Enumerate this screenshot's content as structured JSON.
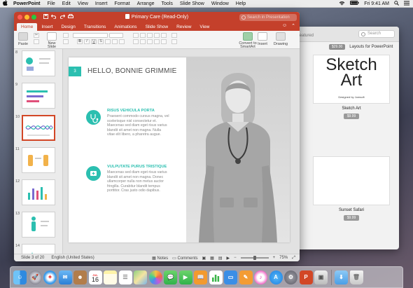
{
  "menubar": {
    "apple": "",
    "app_name": "PowerPoint",
    "items": [
      "File",
      "Edit",
      "View",
      "Insert",
      "Format",
      "Arrange",
      "Tools",
      "Slide Show",
      "Window",
      "Help"
    ],
    "clock": "Fri 9:41 AM"
  },
  "window": {
    "title": "Primary Care (Read-Only)",
    "search_placeholder": "Search in Presentation",
    "tabs": [
      "Home",
      "Insert",
      "Design",
      "Transitions",
      "Animations",
      "Slide Show",
      "Review",
      "View"
    ],
    "active_tab": "Home"
  },
  "ribbon": {
    "paste": "Paste",
    "new_slide": "New\nSlide",
    "convert_smartart": "Convert to\nSmartArt",
    "insert": "Insert",
    "drawing": "Drawing"
  },
  "thumbnails": [
    {
      "num": "8"
    },
    {
      "num": "9"
    },
    {
      "num": "10"
    },
    {
      "num": "11"
    },
    {
      "num": "12"
    },
    {
      "num": "13"
    },
    {
      "num": "14"
    }
  ],
  "slide": {
    "number": "3",
    "title": "HELLO, BONNIE GRIMMIE",
    "section1": {
      "heading": "RISUS VEHICULA PORTA",
      "body": [
        "Praesent commodo cursus magna, vel",
        "scelerisque nisl consectetur et.",
        "Maecenas sed diam eget risus varius",
        "blandit sit amet non magna. Nulla",
        "vitae elit libero, a pharetra augue."
      ]
    },
    "section2": {
      "heading": "VULPUTATE PURUS TRISTIQUE",
      "body": [
        "Maecenas sed diam eget risus varius",
        "blandit sit amet non magna. Donec",
        "ullamcorper nulla non metus auctor",
        "fringilla. Curabitur blandit tempus",
        "porttitor. Cras justo odio dapibus."
      ]
    }
  },
  "status": {
    "slide_info": "Slide 3 of 20",
    "language": "English (United States)",
    "notes": "Notes",
    "comments": "Comments",
    "zoom": "75%",
    "zoom_fraction": 0.5
  },
  "store": {
    "tab_label": "Featured",
    "search_placeholder": "Search",
    "header_price": "$29.00",
    "header_title": "Layouts for PowerPoint",
    "cards": [
      {
        "thumb_title": "Sketch\nArt",
        "thumb_sub": "Designed by Jumsoft",
        "name": "Sketch Art",
        "price": "$9.99"
      },
      {
        "thumb_title": "Sunset Safari",
        "name": "Sunset Safari",
        "price": "$9.99"
      }
    ]
  },
  "dock": {
    "apps": [
      "finder",
      "launchpad",
      "safari",
      "mail",
      "contacts",
      "calendar",
      "notes",
      "reminders",
      "maps",
      "photos",
      "messages",
      "facetime",
      "ibooks",
      "numbers",
      "keynote",
      "pages",
      "itunes",
      "app-store",
      "system-preferences",
      "powerpoint",
      "preview",
      "downloads-folder",
      "trash"
    ],
    "calendar_month": "JUL",
    "calendar_day": "16"
  },
  "colors": {
    "ppt_red": "#c4402b",
    "accent_teal": "#2bbfb0",
    "store_pink": "#e8375a"
  }
}
